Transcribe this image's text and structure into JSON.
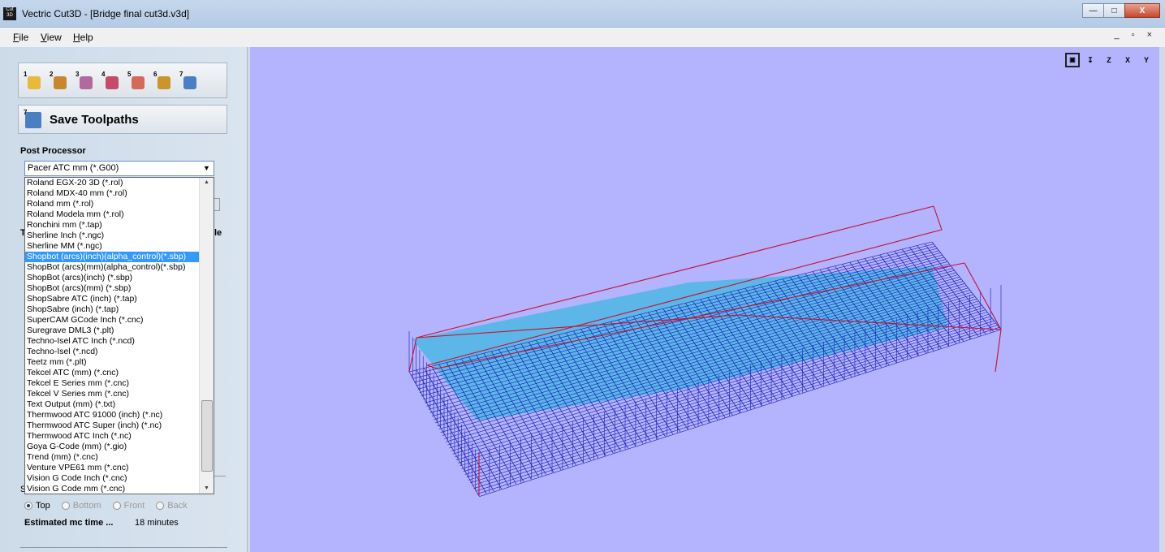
{
  "window": {
    "app_icon_text": "Cut 3D",
    "title": "Vectric Cut3D - [Bridge final cut3d.v3d]",
    "minimize": "—",
    "maximize": "□",
    "close": "X"
  },
  "menu": {
    "items": [
      "File",
      "View",
      "Help"
    ],
    "mdi_controls": "_ ▫ ×"
  },
  "toolbar": {
    "buttons": [
      {
        "num": "1",
        "icon": "open-folder-icon",
        "color": "#e8b93a"
      },
      {
        "num": "2",
        "icon": "orient-model-icon",
        "color": "#c8862e"
      },
      {
        "num": "3",
        "icon": "position-model-icon",
        "color": "#b06aa0"
      },
      {
        "num": "4",
        "icon": "roughing-toolpath-icon",
        "color": "#c74a6a"
      },
      {
        "num": "5",
        "icon": "finishing-toolpath-icon",
        "color": "#d66a5a"
      },
      {
        "num": "6",
        "icon": "preview-toolpath-icon",
        "color": "#c9952c"
      },
      {
        "num": "7",
        "icon": "save-toolpaths-icon",
        "color": "#4a7fc4"
      }
    ],
    "save": {
      "num": "7",
      "label": "Save Toolpaths"
    }
  },
  "post_processor": {
    "label": "Post Processor",
    "selected": "Pacer ATC mm (*.G00)",
    "options": [
      "Roland EGX-20 3D (*.rol)",
      "Roland MDX-40 mm (*.rol)",
      "Roland mm (*.rol)",
      "Roland Modela mm (*.rol)",
      "Ronchini mm (*.tap)",
      "Sherline Inch (*.ngc)",
      "Sherline MM (*.ngc)",
      "Shopbot (arcs)(inch)(alpha_control)(*.sbp)",
      "ShopBot (arcs)(mm)(alpha_control)(*.sbp)",
      "ShopBot (arcs)(inch) (*.sbp)",
      "ShopBot (arcs)(mm) (*.sbp)",
      "ShopSabre ATC (inch) (*.tap)",
      "ShopSabre (inch) (*.tap)",
      "SuperCAM GCode Inch (*.cnc)",
      "Suregrave DML3 (*.plt)",
      "Techno-Isel ATC Inch (*.ncd)",
      "Techno-Isel (*.ncd)",
      "Teetz mm (*.plt)",
      "Tekcel ATC (mm) (*.cnc)",
      "Tekcel E Series mm (*.cnc)",
      "Tekcel V Series mm (*.cnc)",
      "Text Output (mm) (*.txt)",
      "Thermwood ATC 91000 (inch) (*.nc)",
      "Thermwood ATC Super (inch) (*.nc)",
      "Thermwood ATC Inch (*.nc)",
      "Goya G-Code (mm) (*.gio)",
      "Trend (mm) (*.cnc)",
      "Venture VPE61 mm (*.cnc)",
      "Vision G Code Inch (*.cnc)",
      "Vision G Code mm (*.cnc)"
    ],
    "highlighted_index": 7
  },
  "obscured": {
    "t": "T",
    "le": "le",
    "s": "S"
  },
  "view_side": {
    "options": [
      {
        "label": "Top",
        "selected": true,
        "enabled": true
      },
      {
        "label": "Bottom",
        "selected": false,
        "enabled": false
      },
      {
        "label": "Front",
        "selected": false,
        "enabled": false
      },
      {
        "label": "Back",
        "selected": false,
        "enabled": false
      }
    ]
  },
  "estimate": {
    "label": "Estimated mc time ...",
    "value": "18 minutes"
  },
  "viewport": {
    "background": "#b3b3fe",
    "view_buttons": [
      {
        "name": "zoom-fit-icon",
        "text": "▣"
      },
      {
        "name": "iso-view-icon",
        "text": "↧"
      },
      {
        "name": "view-z-icon",
        "text": "Z"
      },
      {
        "name": "view-x-icon",
        "text": "X"
      },
      {
        "name": "view-y-icon",
        "text": "Y"
      }
    ],
    "colors": {
      "mesh": "#1a1ab8",
      "surface": "#3fb8e0",
      "rapid": "#c8102e"
    }
  }
}
